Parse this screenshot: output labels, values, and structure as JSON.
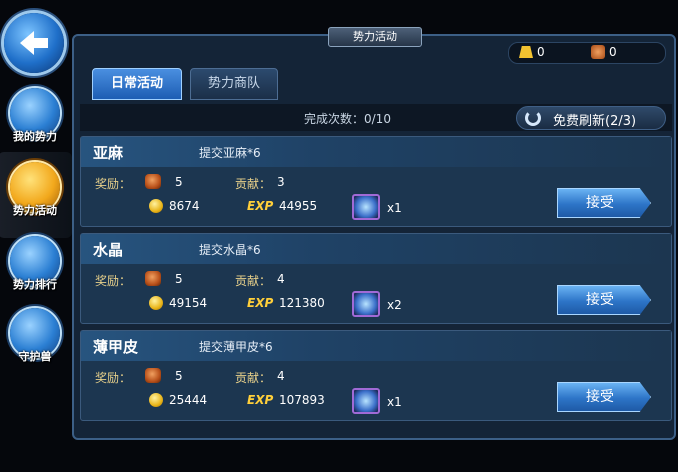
{
  "sidebar": {
    "items": [
      {
        "label": "我的势力",
        "icon": "temple-icon",
        "active": false
      },
      {
        "label": "势力活动",
        "icon": "cloud-icon",
        "active": true
      },
      {
        "label": "势力排行",
        "icon": "ranking-icon",
        "active": false
      },
      {
        "label": "守护兽",
        "icon": "beast-icon",
        "active": false
      }
    ]
  },
  "header": {
    "title": "势力活动"
  },
  "resources": {
    "gold_bars": "0",
    "items": "0"
  },
  "tabs": [
    {
      "label": "日常活动",
      "active": true
    },
    {
      "label": "势力商队",
      "active": false
    }
  ],
  "status": {
    "completion": "完成次数：0/10",
    "refresh_label": "免费刷新(2/3)"
  },
  "tasks": [
    {
      "name": "亚麻",
      "task": "提交亚麻*6",
      "reward_label": "奖励：",
      "reward_bags": "5",
      "contribution_label": "贡献：",
      "contribution": "3",
      "coins": "8674",
      "exp_label": "EXP",
      "exp": "44955",
      "item_qty": "x1",
      "accept_label": "接受"
    },
    {
      "name": "水晶",
      "task": "提交水晶*6",
      "reward_label": "奖励：",
      "reward_bags": "5",
      "contribution_label": "贡献：",
      "contribution": "4",
      "coins": "49154",
      "exp_label": "EXP",
      "exp": "121380",
      "item_qty": "x2",
      "accept_label": "接受"
    },
    {
      "name": "薄甲皮",
      "task": "提交薄甲皮*6",
      "reward_label": "奖励：",
      "reward_bags": "5",
      "contribution_label": "贡献：",
      "contribution": "4",
      "coins": "25444",
      "exp_label": "EXP",
      "exp": "107893",
      "item_qty": "x1",
      "accept_label": "接受"
    }
  ],
  "colors": {
    "accent": "#2d74c7",
    "gold": "#ffcf3a",
    "panel": "#142437"
  }
}
